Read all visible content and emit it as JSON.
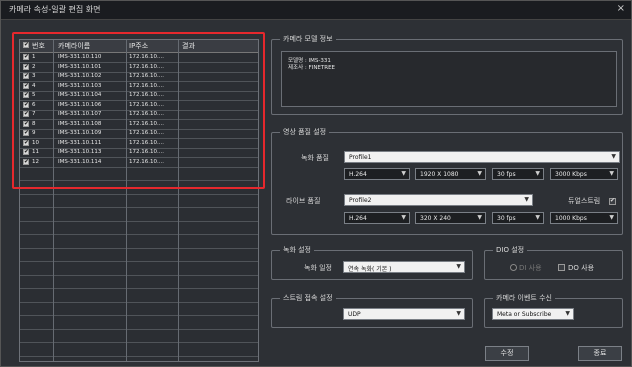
{
  "window": {
    "title": "카메라 속성-일괄 편집 화면",
    "close_label": "×"
  },
  "table": {
    "headers": [
      "번호",
      "카메라이름",
      "IP주소",
      "결과"
    ],
    "rows": [
      {
        "num": "1",
        "name": "IMS-331.10.110",
        "ip": "172.16.10....",
        "result": ""
      },
      {
        "num": "2",
        "name": "IMS-331.10.101",
        "ip": "172.16.10....",
        "result": ""
      },
      {
        "num": "3",
        "name": "IMS-331.10.102",
        "ip": "172.16.10....",
        "result": ""
      },
      {
        "num": "4",
        "name": "IMS-331.10.103",
        "ip": "172.16.10....",
        "result": ""
      },
      {
        "num": "5",
        "name": "IMS-331.10.104",
        "ip": "172.16.10....",
        "result": ""
      },
      {
        "num": "6",
        "name": "IMS-331.10.106",
        "ip": "172.16.10....",
        "result": ""
      },
      {
        "num": "7",
        "name": "IMS-331.10.107",
        "ip": "172.16.10....",
        "result": ""
      },
      {
        "num": "8",
        "name": "IMS-331.10.108",
        "ip": "172.16.10....",
        "result": ""
      },
      {
        "num": "9",
        "name": "IMS-331.10.109",
        "ip": "172.16.10....",
        "result": ""
      },
      {
        "num": "10",
        "name": "IMS-331.10.111",
        "ip": "172.16.10....",
        "result": ""
      },
      {
        "num": "11",
        "name": "IMS-331.10.113",
        "ip": "172.16.10....",
        "result": ""
      },
      {
        "num": "12",
        "name": "IMS-331.10.114",
        "ip": "172.16.10....",
        "result": ""
      }
    ]
  },
  "model_info": {
    "title": "카메라 모델 정보",
    "model_line": "모델명 : IMS-331",
    "maker_line": "제조사 : FINETREE"
  },
  "video": {
    "title": "영상 품질 설정",
    "record_label": "녹화 품질",
    "record_profile": "Profile1",
    "record_codec": "H.264",
    "record_res": "1920 X 1080",
    "record_fps": "30 fps",
    "record_bitrate": "3000 Kbps",
    "live_label": "라이브 품질",
    "live_profile": "Profile2",
    "dual_stream_label": "듀얼스트림",
    "live_codec": "H.264",
    "live_res": "320 X 240",
    "live_fps": "30 fps",
    "live_bitrate": "1000 Kbps"
  },
  "record": {
    "title": "녹화 설정",
    "mode_label": "녹화 일정",
    "mode_value": "연속 녹화( 기본 )"
  },
  "dio": {
    "title": "DIO 설정",
    "di_label": "DI 사용",
    "do_label": "DO 사용"
  },
  "stream": {
    "title": "스트림 접속 설정",
    "value": "UDP"
  },
  "event": {
    "title": "카메라 이벤트 수신",
    "value": "Meta or Subscribe"
  },
  "buttons": {
    "edit": "수정",
    "close": "종료"
  }
}
